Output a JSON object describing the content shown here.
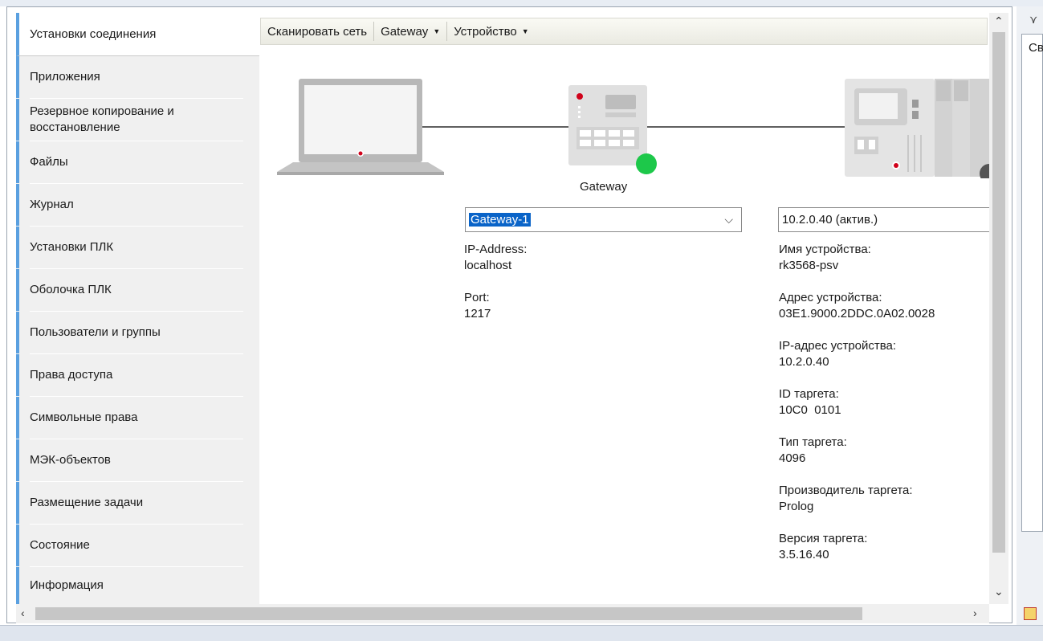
{
  "sidebar": {
    "items": [
      {
        "label": "Установки соединения",
        "active": true
      },
      {
        "label": "Приложения"
      },
      {
        "label": "Резервное копирование и восстановление"
      },
      {
        "label": "Файлы"
      },
      {
        "label": "Журнал"
      },
      {
        "label": "Установки ПЛК"
      },
      {
        "label": "Оболочка ПЛК"
      },
      {
        "label": "Пользователи и группы"
      },
      {
        "label": "Права доступа"
      },
      {
        "label": "Символьные права"
      },
      {
        "label": "МЭК-объектов"
      },
      {
        "label": "Размещение задачи"
      },
      {
        "label": "Состояние"
      },
      {
        "label": "Информация"
      }
    ]
  },
  "toolbar": {
    "scan": "Сканировать сеть",
    "gateway": "Gateway",
    "device": "Устройство"
  },
  "gateway": {
    "label": "Gateway",
    "combo_value": "Gateway-1",
    "ip_label": "IP-Address:",
    "ip_value": "localhost",
    "port_label": "Port:",
    "port_value": "1217"
  },
  "device": {
    "combo_value": "10.2.0.40 (актив.)",
    "name_label": "Имя устройства:",
    "name_value": "rk3568-psv",
    "address_label": "Адрес устройства:",
    "address_value": "03E1.9000.2DDC.0A02.0028",
    "ip_label": "IP-адрес устройства:",
    "ip_value": "10.2.0.40",
    "target_id_label": "ID таргета:",
    "target_id_value": "10C0  0101",
    "target_type_label": "Тип таргета:",
    "target_type_value": "4096",
    "vendor_label": "Производитель таргета:",
    "vendor_value": "Prolog",
    "version_label": "Версия таргета:",
    "version_value": "3.5.16.40"
  },
  "right_panel": {
    "text": "Св"
  },
  "colors": {
    "accent": "#5aa0e0",
    "status_ok": "#1dc84a",
    "selection": "#0a64c8"
  }
}
